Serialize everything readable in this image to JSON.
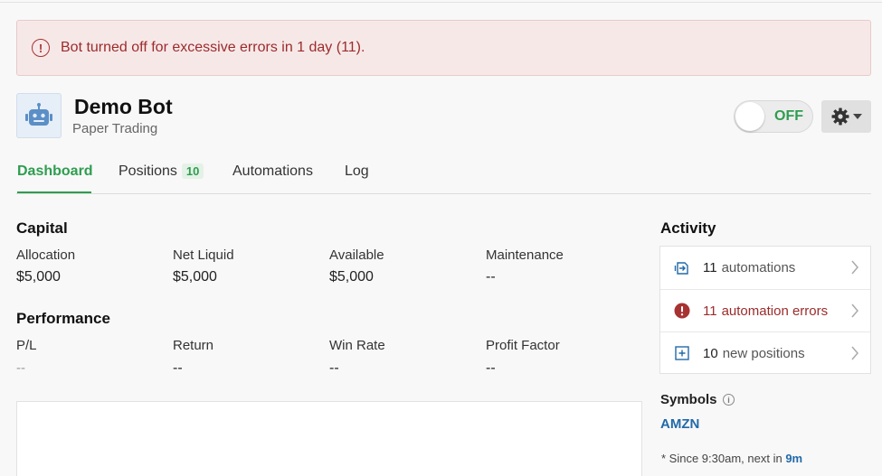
{
  "alert": {
    "message": "Bot turned off for excessive errors in 1 day (11)."
  },
  "bot": {
    "name": "Demo Bot",
    "mode": "Paper Trading"
  },
  "toggle": {
    "label": "OFF",
    "state": "off"
  },
  "tabs": [
    {
      "label": "Dashboard",
      "active": true
    },
    {
      "label": "Positions",
      "badge": "10"
    },
    {
      "label": "Automations"
    },
    {
      "label": "Log"
    }
  ],
  "capital": {
    "title": "Capital",
    "stats": [
      {
        "label": "Allocation",
        "value": "$5,000"
      },
      {
        "label": "Net Liquid",
        "value": "$5,000"
      },
      {
        "label": "Available",
        "value": "$5,000"
      },
      {
        "label": "Maintenance",
        "value": "--"
      }
    ]
  },
  "performance": {
    "title": "Performance",
    "stats": [
      {
        "label": "P/L",
        "value": "--"
      },
      {
        "label": "Return",
        "value": "--"
      },
      {
        "label": "Win Rate",
        "value": "--"
      },
      {
        "label": "Profit Factor",
        "value": "--"
      }
    ]
  },
  "activity": {
    "title": "Activity",
    "items": [
      {
        "count": "11",
        "text": "automations"
      },
      {
        "count": "11",
        "text": "automation errors"
      },
      {
        "count": "10",
        "text": "new positions"
      }
    ]
  },
  "symbols": {
    "label": "Symbols",
    "items": [
      "AMZN"
    ],
    "note_prefix": "* Since 9:30am, next in ",
    "note_next": "9m"
  },
  "colors": {
    "accent_green": "#2e9d4f",
    "error_red": "#9c2b2b",
    "link_blue": "#2269a8"
  }
}
